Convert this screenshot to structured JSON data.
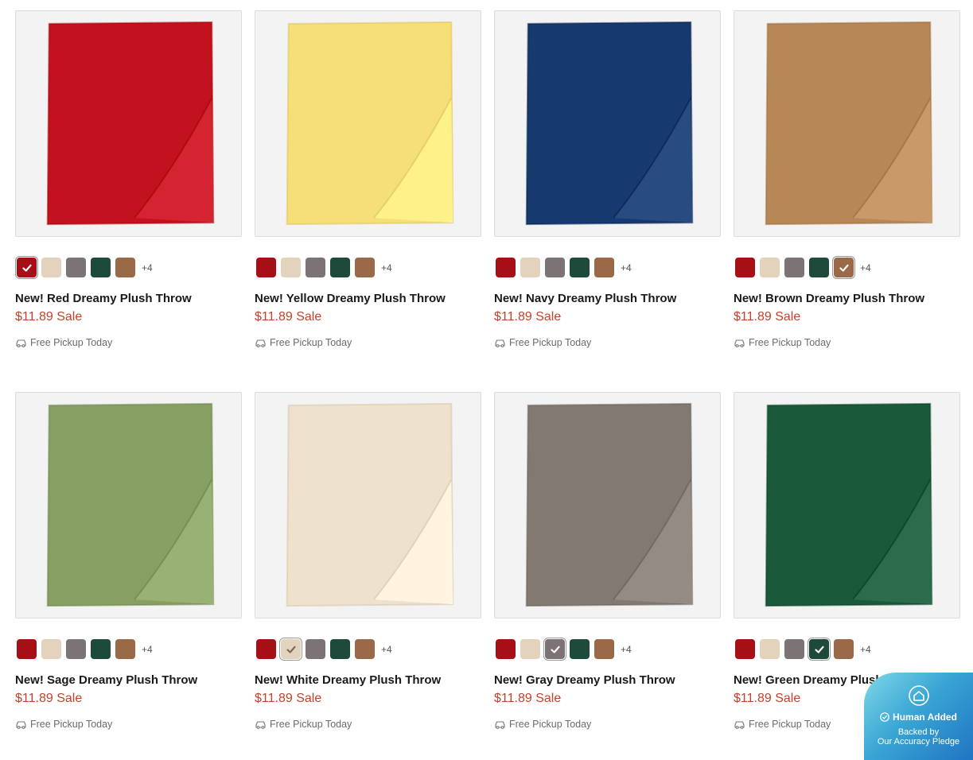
{
  "swatch_colors": [
    "#a50f15",
    "#e3d3bd",
    "#7c7474",
    "#1e4a3b",
    "#9a6a48"
  ],
  "more_colors_label": "+4",
  "pickup_label": "Free Pickup Today",
  "products": [
    {
      "name": "New! Red Dreamy Plush Throw",
      "price": "$11.89 Sale",
      "color": "#c2111f",
      "selected": 0
    },
    {
      "name": "New! Yellow Dreamy Plush Throw",
      "price": "$11.89 Sale",
      "color": "#f6df78",
      "selected": -1
    },
    {
      "name": "New! Navy Dreamy Plush Throw",
      "price": "$11.89 Sale",
      "color": "#173a6e",
      "selected": -1
    },
    {
      "name": "New! Brown Dreamy Plush Throw",
      "price": "$11.89 Sale",
      "color": "#b78756",
      "selected": 4
    },
    {
      "name": "New! Sage Dreamy Plush Throw",
      "price": "$11.89 Sale",
      "color": "#86a063",
      "selected": -1
    },
    {
      "name": "New! White Dreamy Plush Throw",
      "price": "$11.89 Sale",
      "color": "#eee2cc",
      "selected": 1
    },
    {
      "name": "New! Gray Dreamy Plush Throw",
      "price": "$11.89 Sale",
      "color": "#827a72",
      "selected": 2
    },
    {
      "name": "New! Green Dreamy Plush Throw",
      "price": "$11.89 Sale",
      "color": "#1a5a3b",
      "selected": 3
    }
  ],
  "badge": {
    "title": "Human Added",
    "line1": "Backed by",
    "line2": "Our Accuracy Pledge",
    "icon": "home-check-icon"
  }
}
